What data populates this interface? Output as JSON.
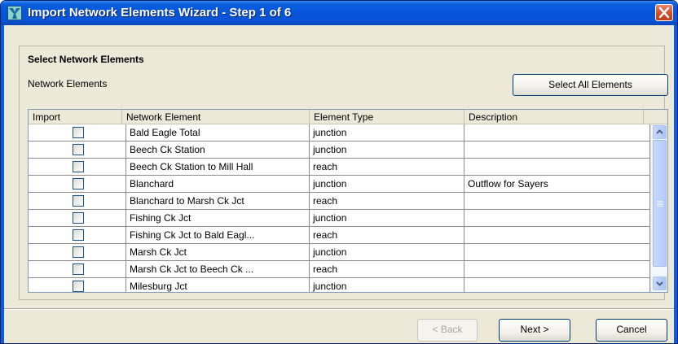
{
  "window": {
    "title": "Import Network Elements Wizard - Step 1 of 6"
  },
  "panel": {
    "section_title": "Select Network Elements",
    "elements_label": "Network Elements",
    "select_all_label": "Select All Elements"
  },
  "table": {
    "columns": [
      "Import",
      "Network Element",
      "Element Type",
      "Description"
    ],
    "rows": [
      {
        "import": false,
        "element": "Bald Eagle Total",
        "type": "junction",
        "description": ""
      },
      {
        "import": false,
        "element": "Beech Ck Station",
        "type": "junction",
        "description": ""
      },
      {
        "import": false,
        "element": "Beech Ck Station to Mill Hall",
        "type": "reach",
        "description": ""
      },
      {
        "import": false,
        "element": "Blanchard",
        "type": "junction",
        "description": "Outflow for Sayers"
      },
      {
        "import": false,
        "element": "Blanchard to Marsh Ck Jct",
        "type": "reach",
        "description": ""
      },
      {
        "import": false,
        "element": "Fishing Ck Jct",
        "type": "junction",
        "description": ""
      },
      {
        "import": false,
        "element": "Fishing Ck Jct to Bald Eagl...",
        "type": "reach",
        "description": ""
      },
      {
        "import": false,
        "element": "Marsh Ck Jct",
        "type": "junction",
        "description": ""
      },
      {
        "import": false,
        "element": "Marsh Ck Jct to Beech Ck ...",
        "type": "reach",
        "description": ""
      },
      {
        "import": false,
        "element": "Milesburg Jct",
        "type": "junction",
        "description": ""
      }
    ]
  },
  "footer": {
    "back_label": "< Back",
    "next_label": "Next >",
    "cancel_label": "Cancel"
  },
  "icons": {
    "app": "network-wizard-icon",
    "close": "close-icon",
    "scroll_up": "arrow-up-icon",
    "scroll_down": "arrow-down-icon"
  },
  "colors": {
    "titlebar": "#0654d8",
    "close": "#d24a26",
    "dialog_bg": "#ece9d8",
    "scrollbar": "#b4cbf6"
  }
}
